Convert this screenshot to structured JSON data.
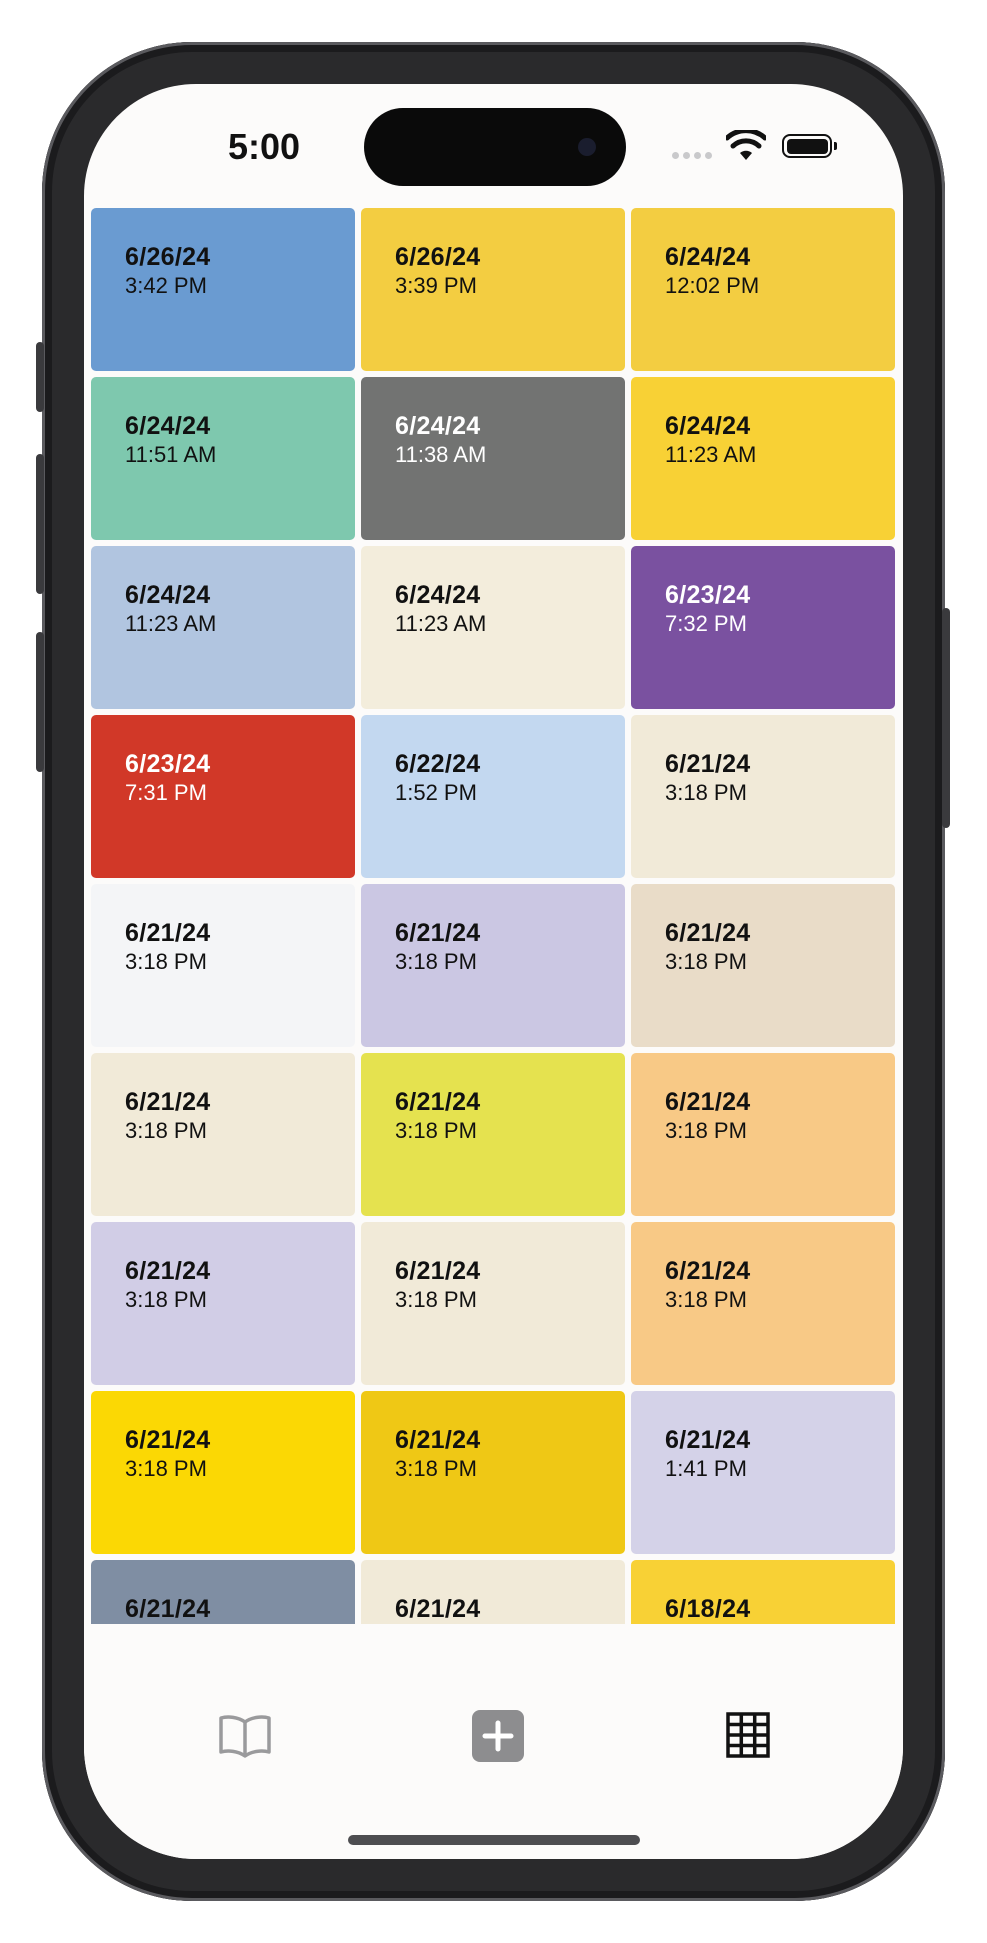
{
  "status_bar": {
    "time": "5:00"
  },
  "entries": [
    {
      "date": "6/26/24",
      "time": "3:42 PM",
      "color": "#6a9bd1",
      "light_text": false
    },
    {
      "date": "6/26/24",
      "time": "3:39 PM",
      "color": "#f3cd41",
      "light_text": false
    },
    {
      "date": "6/24/24",
      "time": "12:02 PM",
      "color": "#f3cd41",
      "light_text": false
    },
    {
      "date": "6/24/24",
      "time": "11:51 AM",
      "color": "#7ec8ae",
      "light_text": false
    },
    {
      "date": "6/24/24",
      "time": "11:38 AM",
      "color": "#727372",
      "light_text": true
    },
    {
      "date": "6/24/24",
      "time": "11:23 AM",
      "color": "#f8d135",
      "light_text": false
    },
    {
      "date": "6/24/24",
      "time": "11:23 AM",
      "color": "#b1c5e0",
      "light_text": false
    },
    {
      "date": "6/24/24",
      "time": "11:23 AM",
      "color": "#f3eddc",
      "light_text": false
    },
    {
      "date": "6/23/24",
      "time": "7:32 PM",
      "color": "#7a51a0",
      "light_text": true
    },
    {
      "date": "6/23/24",
      "time": "7:31 PM",
      "color": "#d13828",
      "light_text": true
    },
    {
      "date": "6/22/24",
      "time": "1:52 PM",
      "color": "#c3d8f0",
      "light_text": false
    },
    {
      "date": "6/21/24",
      "time": "3:18 PM",
      "color": "#f1ead8",
      "light_text": false
    },
    {
      "date": "6/21/24",
      "time": "3:18 PM",
      "color": "#f4f5f7",
      "light_text": false
    },
    {
      "date": "6/21/24",
      "time": "3:18 PM",
      "color": "#cbc7e3",
      "light_text": false
    },
    {
      "date": "6/21/24",
      "time": "3:18 PM",
      "color": "#e9dcc8",
      "light_text": false
    },
    {
      "date": "6/21/24",
      "time": "3:18 PM",
      "color": "#f1ead8",
      "light_text": false
    },
    {
      "date": "6/21/24",
      "time": "3:18 PM",
      "color": "#e5e24f",
      "light_text": false
    },
    {
      "date": "6/21/24",
      "time": "3:18 PM",
      "color": "#f8c986",
      "light_text": false
    },
    {
      "date": "6/21/24",
      "time": "3:18 PM",
      "color": "#d1cde6",
      "light_text": false
    },
    {
      "date": "6/21/24",
      "time": "3:18 PM",
      "color": "#f1ead8",
      "light_text": false
    },
    {
      "date": "6/21/24",
      "time": "3:18 PM",
      "color": "#f8c986",
      "light_text": false
    },
    {
      "date": "6/21/24",
      "time": "3:18 PM",
      "color": "#fbd804",
      "light_text": false
    },
    {
      "date": "6/21/24",
      "time": "3:18 PM",
      "color": "#efc815",
      "light_text": false
    },
    {
      "date": "6/21/24",
      "time": "1:41 PM",
      "color": "#d4d2e8",
      "light_text": false
    },
    {
      "date": "6/21/24",
      "time": "",
      "color": "#7f8ea3",
      "light_text": false
    },
    {
      "date": "6/21/24",
      "time": "",
      "color": "#f1ead8",
      "light_text": false
    },
    {
      "date": "6/18/24",
      "time": "",
      "color": "#f8d135",
      "light_text": false
    }
  ],
  "tab_bar": {
    "items": [
      {
        "icon": "book-icon",
        "color": "#9a9a9c"
      },
      {
        "icon": "plus-square-icon",
        "color": "#8d8d8f"
      },
      {
        "icon": "grid-icon",
        "color": "#111111"
      }
    ]
  }
}
